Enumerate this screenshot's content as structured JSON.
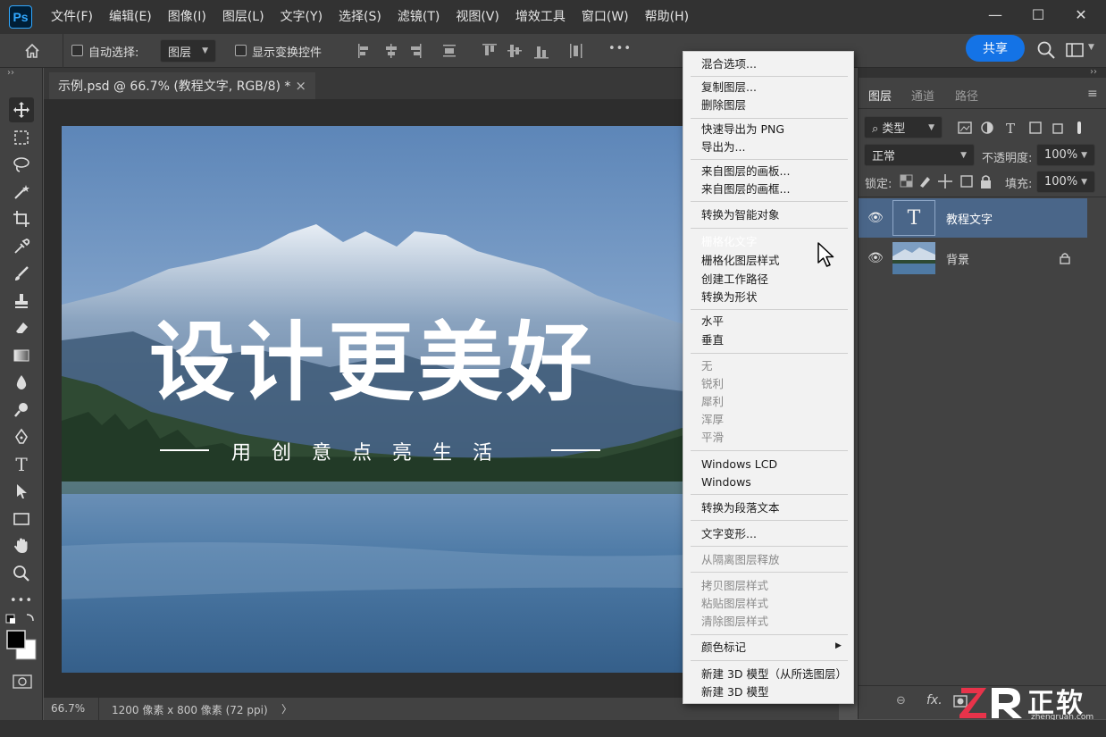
{
  "app": {
    "logo": "Ps"
  },
  "menubar": {
    "items": [
      "文件(F)",
      "编辑(E)",
      "图像(I)",
      "图层(L)",
      "文字(Y)",
      "选择(S)",
      "滤镜(T)",
      "视图(V)",
      "增效工具",
      "窗口(W)",
      "帮助(H)"
    ]
  },
  "window_controls": {
    "minimize": "—",
    "maximize": "☐",
    "close": "✕"
  },
  "options_bar": {
    "auto_select_label": "自动选择:",
    "layer_select_value": "图层",
    "show_transform_label": "显示变换控件",
    "more_label": "•••",
    "share_label": "共享"
  },
  "document": {
    "tab_title": "示例.psd @ 66.7% (教程文字, RGB/8) *",
    "tab_close": "×",
    "headline": "设计更美好",
    "subline": "用 创 意 点 亮 生 活"
  },
  "status_bar": {
    "zoom": "66.7%",
    "info": "1200 像素 x 800 像素 (72 ppi)",
    "arrow": "〉"
  },
  "panel": {
    "tabs": [
      "图层",
      "通道",
      "路径"
    ],
    "filter_value": "类型",
    "blend_value": "正常",
    "opacity_label": "不透明度:",
    "opacity_value": "100%",
    "lock_label": "锁定:",
    "fill_label": "填充:",
    "fill_value": "100%",
    "layers": [
      {
        "name": "教程文字",
        "thumb": "T"
      },
      {
        "name": "背景"
      }
    ],
    "footer_fx": "fx."
  },
  "context_menu": {
    "items": {
      "blend_options": "混合选项...",
      "duplicate_layer": "复制图层...",
      "delete_layer": "删除图层",
      "quick_export_png": "快速导出为 PNG",
      "export_as": "导出为...",
      "artboard_from_layers": "来自图层的画板...",
      "frame_from_layers": "来自图层的画框...",
      "convert_smart_object": "转换为智能对象",
      "rasterize_type": "栅格化文字",
      "rasterize_layer_style": "栅格化图层样式",
      "create_work_path": "创建工作路径",
      "convert_to_shape": "转换为形状",
      "horizontal": "水平",
      "vertical": "垂直",
      "aa_none": "无",
      "aa_sharp": "锐利",
      "aa_crisp": "犀利",
      "aa_strong": "浑厚",
      "aa_smooth": "平滑",
      "windows_lcd": "Windows LCD",
      "windows": "Windows",
      "convert_paragraph": "转换为段落文本",
      "warp_text": "文字变形...",
      "release_isolation": "从隔离图层释放",
      "copy_layer_style": "拷贝图层样式",
      "paste_layer_style": "粘贴图层样式",
      "clear_layer_style": "清除图层样式",
      "color_label": "颜色标记",
      "new_3d_from_selected": "新建 3D 模型（从所选图层）",
      "new_3d_model": "新建 3D 模型"
    }
  },
  "watermark": {
    "brand": "正软",
    "url": "zhengruan.com"
  },
  "colors": {
    "accent": "#1473e6",
    "ps_blue": "#31a8ff",
    "panel_bg": "#424242"
  }
}
